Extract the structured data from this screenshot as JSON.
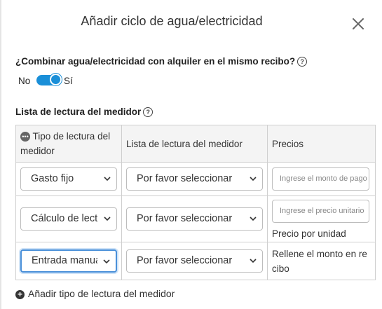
{
  "dialog": {
    "title": "Añadir ciclo de agua/electricidad",
    "question": "¿Combinar agua/electricidad con alquiler en el mismo recibo?",
    "toggle": {
      "off_label": "No",
      "on_label": "Sí",
      "state": "on"
    },
    "section_title": "Lista de lectura del medidor",
    "add_link": "Añadir tipo de lectura del medidor"
  },
  "table": {
    "headers": [
      "Tipo de lectura del medidor",
      "Lista de lectura del medidor",
      "Precios"
    ],
    "rows": [
      {
        "type": "Gasto fijo",
        "meter": "Por favor seleccionar",
        "price_placeholder": "Ingrese el monto de pago",
        "price_unit": "",
        "note": ""
      },
      {
        "type": "Cálculo de lectura",
        "meter": "Por favor seleccionar",
        "price_placeholder": "Ingrese el precio unitario",
        "price_unit": "Precio por unidad",
        "note": ""
      },
      {
        "type": "Entrada manual",
        "meter": "Por favor seleccionar",
        "price_placeholder": "",
        "price_unit": "",
        "note": "Rellene el monto en recibo"
      }
    ]
  },
  "colors": {
    "accent": "#1a8fd8",
    "focus": "#4a90d9",
    "header_bg": "#f4f4f4"
  },
  "icons": [
    "close-icon",
    "help-icon",
    "chevron-down-icon",
    "plus-circle-icon",
    "chat-icon"
  ]
}
